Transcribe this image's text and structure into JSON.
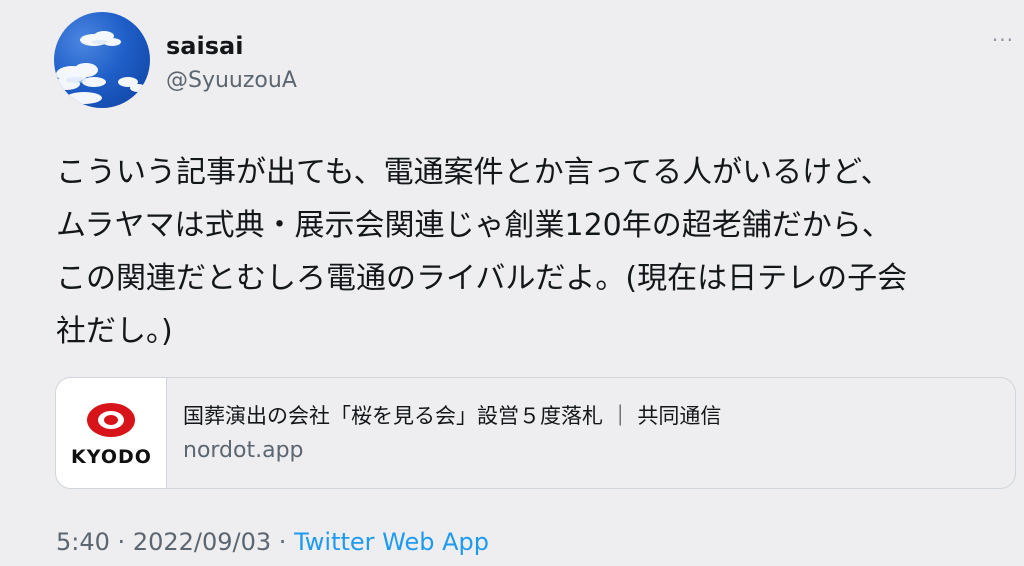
{
  "user": {
    "display_name": "saisai",
    "handle": "@SyuuzouA"
  },
  "menu": {
    "more_label": "···"
  },
  "tweet": {
    "text": "こういう記事が出ても、電通案件とか言ってる人がいるけど、\nムラヤマは式典・展示会関連じゃ創業120年の超老舗だから、\nこの関連だとむしろ電通のライバルだよ。(現在は日テレの子会\n社だし。)"
  },
  "link_card": {
    "logo_text": "KYODO",
    "title": "国葬演出の会社「桜を見る会」設営５度落札 ｜ 共同通信",
    "domain": "nordot.app"
  },
  "footer": {
    "time": "5:40",
    "date": "2022/09/03",
    "separator": "·",
    "source": "Twitter Web App"
  },
  "colors": {
    "background": "#eeeef0",
    "link": "#1d9bf0",
    "secondary_text": "#5b6670",
    "kyodo_red": "#d7141a"
  }
}
